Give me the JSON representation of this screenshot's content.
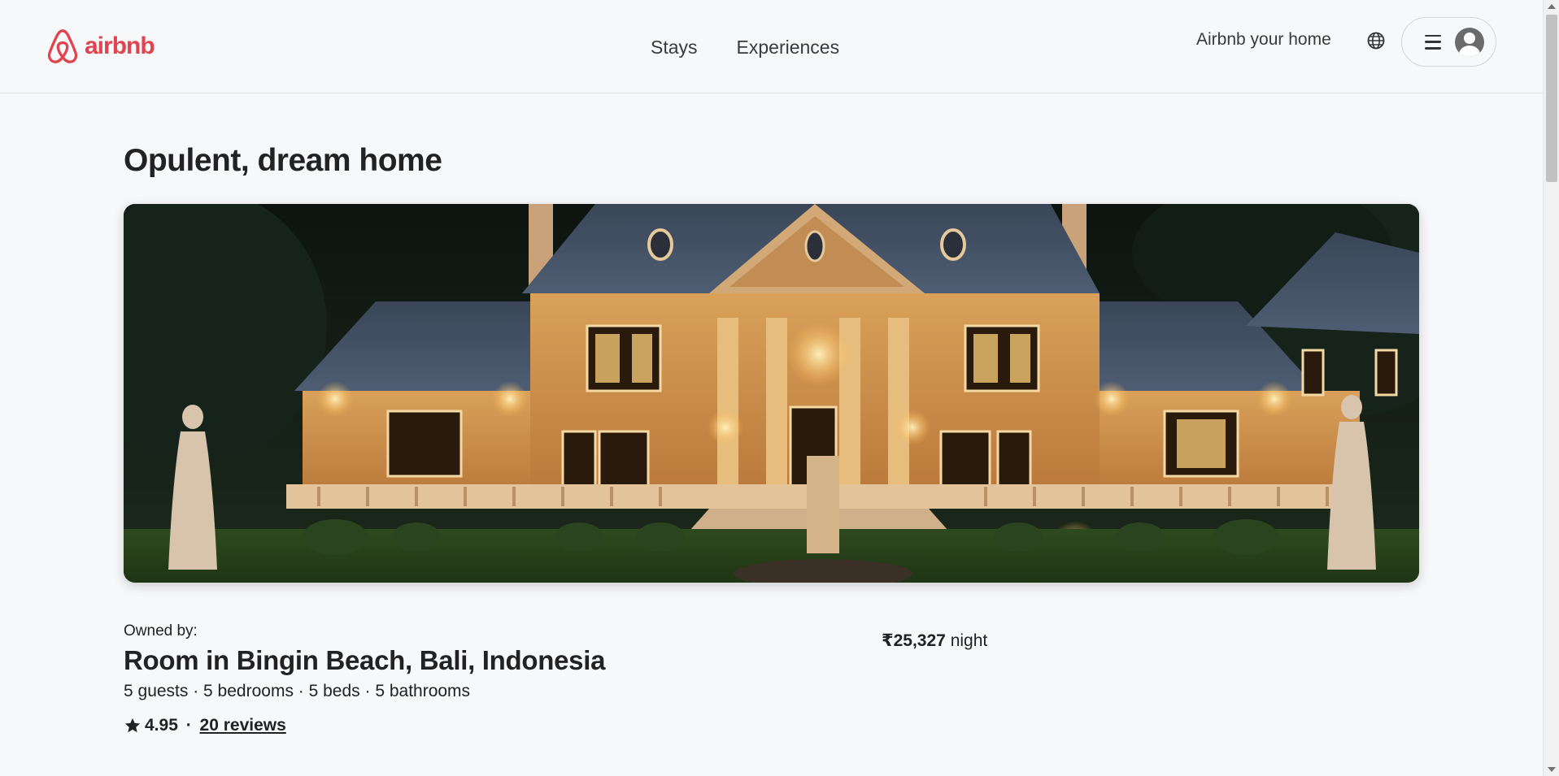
{
  "header": {
    "logo_text": "airbnb",
    "nav": [
      {
        "label": "Stays"
      },
      {
        "label": "Experiences"
      }
    ],
    "host_link": "Airbnb your home",
    "icons": {
      "language": "globe-icon",
      "menu": "hamburger-menu-icon",
      "profile": "user-avatar-icon"
    }
  },
  "listing": {
    "title": "Opulent, dream home",
    "owned_by_label": "Owned by:",
    "location_title": "Room in Bingin Beach, Bali, Indonesia",
    "details": "5 guests · 5 bedrooms · 5 beds · 5 bathrooms",
    "rating": "4.95",
    "separator": " · ",
    "reviews": "20 reviews",
    "price_amount": "₹25,327",
    "price_unit": "night"
  },
  "colors": {
    "brand": "#e0454f",
    "text": "#222222",
    "background": "#f7f8fa"
  }
}
